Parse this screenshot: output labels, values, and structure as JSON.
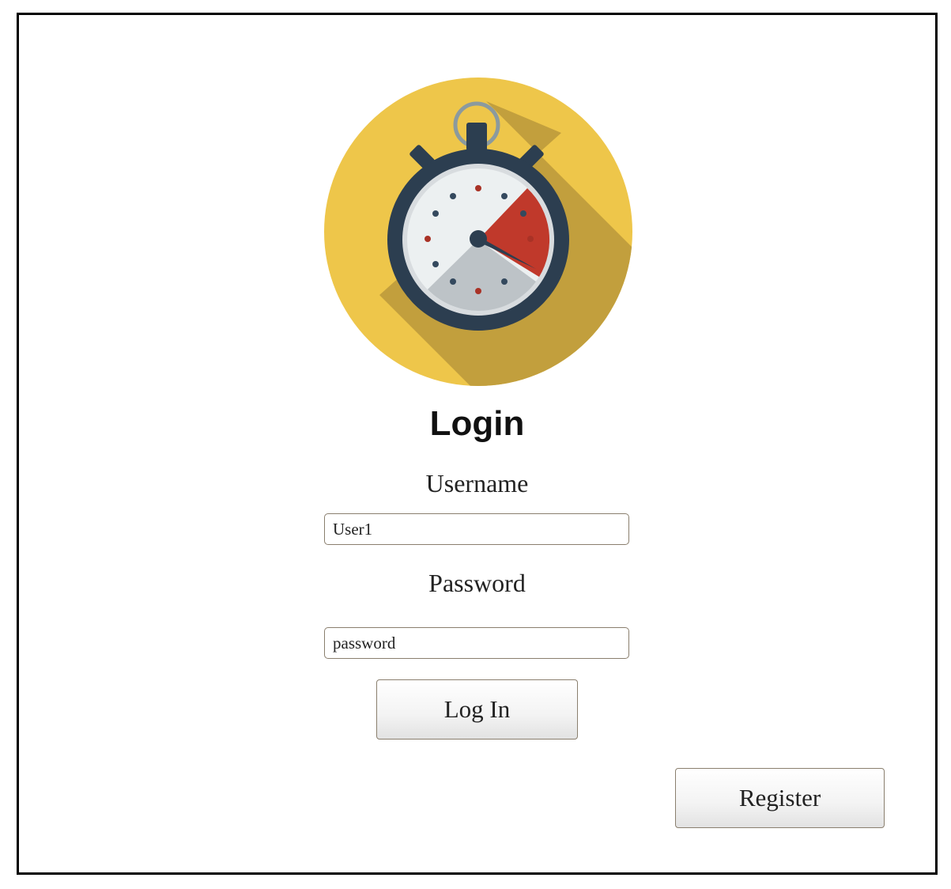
{
  "logo": {
    "icon": "stopwatch-icon",
    "background_color": "#EEC64A"
  },
  "form": {
    "title": "Login",
    "username_label": "Username",
    "username_value": "User1",
    "password_label": "Password",
    "password_value": "password",
    "login_button": "Log In"
  },
  "register_button": "Register"
}
